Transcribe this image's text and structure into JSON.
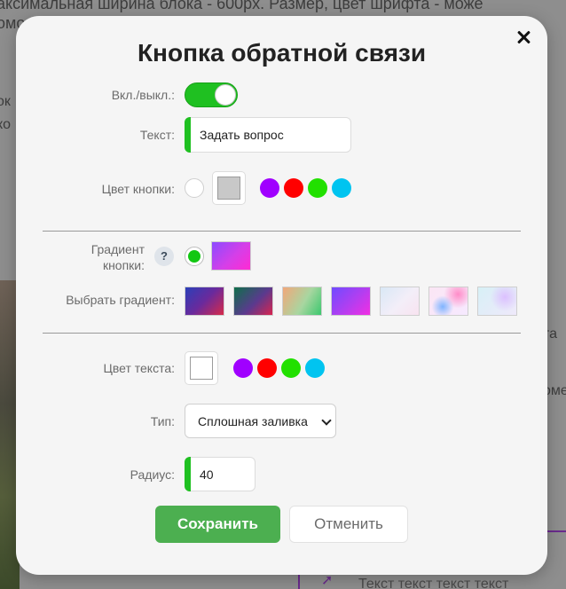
{
  "background": {
    "top_line": "аксимальная ширина блока - 600px. Размер, цвет шрифта - може",
    "top_line2": "омо",
    "left_line1": "ок",
    "left_line2": "ко",
    "right_line1": "та",
    "right_line2": "оме",
    "bottom_text": "Текст  текст  текст  текст"
  },
  "modal": {
    "title": "Кнопка обратной связи",
    "close_icon": "close-icon",
    "enable": {
      "label": "Вкл./выкл.:",
      "value": true
    },
    "text": {
      "label": "Текст:",
      "value": "Задать вопрос"
    },
    "button_color": {
      "label": "Цвет кнопки:",
      "selected": "#c8c8c8",
      "swatches": [
        "#ffffff",
        "#a000ff",
        "#ff0000",
        "#22e000",
        "#00c4f0"
      ]
    },
    "gradient": {
      "label": "Градиент кнопки:",
      "label_line1": "Градиент",
      "label_line2": "кнопки:",
      "help": "?",
      "enabled_color": "#12c712",
      "preview": "linear-gradient(135deg, #8b4bff 0%, #d53fe8 55%, #ff2ad3 100%)"
    },
    "choose_gradient": {
      "label": "Выбрать градиент:",
      "options": [
        "linear-gradient(135deg, #2b3fb8 0%, #6a2a9c 50%, #d72a4a 100%)",
        "linear-gradient(135deg, #0f6f4a 0%, #5a3a8e 55%, #d8244f 100%)",
        "linear-gradient(120deg, #f2a77a 0%, #a8d6a0 55%, #3cc86e 100%)",
        "linear-gradient(135deg, #6f4bff 0%, #b43ef0 55%, #f22ee3 100%)",
        "linear-gradient(135deg, #d9e8f6 0%, #f3eef8 55%, #f8e3f0 100%)",
        "radial-gradient(circle at 35% 70%, #7fb4ff 0%, rgba(127,180,255,0) 35%), radial-gradient(circle at 75% 25%, #ff8cc8 0%, rgba(255,140,200,0) 40%), linear-gradient(135deg, #fbe6f4 0%, #f6e9ff 100%)",
        "radial-gradient(circle at 70% 35%, #dcc0ff 0%, rgba(220,192,255,0) 45%), linear-gradient(135deg, #d7f0f6 0%, #efe9fb 100%)"
      ]
    },
    "text_color": {
      "label": "Цвет текста:",
      "selected": "#ffffff",
      "swatches": [
        "#a000ff",
        "#ff0000",
        "#22e000",
        "#00c4f0"
      ]
    },
    "type": {
      "label": "Тип:",
      "value": "Сплошная заливка"
    },
    "radius": {
      "label": "Радиус:",
      "value": "40"
    },
    "save_label": "Сохранить",
    "cancel_label": "Отменить",
    "accent": "#1fc021",
    "save_color": "#4caf50"
  }
}
